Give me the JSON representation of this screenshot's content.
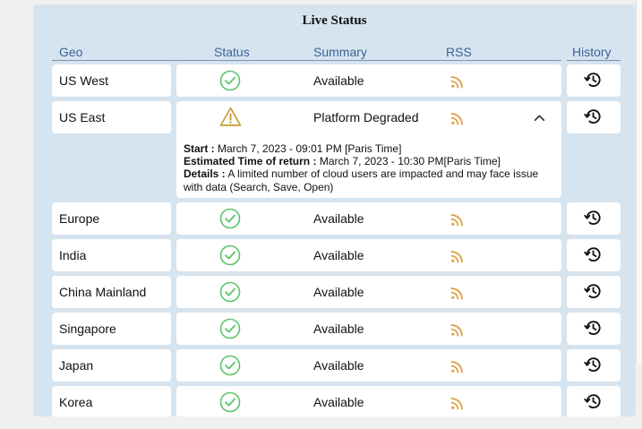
{
  "title": "Live Status",
  "headers": {
    "geo": "Geo",
    "status": "Status",
    "summary": "Summary",
    "rss": "RSS",
    "history": "History"
  },
  "rows": [
    {
      "geo": "US West",
      "status": "ok",
      "summary": "Available"
    },
    {
      "geo": "US East",
      "status": "warning",
      "summary": "Platform Degraded",
      "details": {
        "start_label": "Start :",
        "start_value": " March 7, 2023 - 09:01 PM [Paris Time]",
        "eta_label": "Estimated Time of return :",
        "eta_value": " March 7, 2023 - 10:30 PM[Paris Time]",
        "details_label": "Details :",
        "details_value": " A limited number of cloud users are impacted and may face issue with data (Search, Save, Open)"
      }
    },
    {
      "geo": "Europe",
      "status": "ok",
      "summary": "Available"
    },
    {
      "geo": "India",
      "status": "ok",
      "summary": "Available"
    },
    {
      "geo": "China Mainland",
      "status": "ok",
      "summary": "Available"
    },
    {
      "geo": "Singapore",
      "status": "ok",
      "summary": "Available"
    },
    {
      "geo": "Japan",
      "status": "ok",
      "summary": "Available"
    },
    {
      "geo": "Korea",
      "status": "ok",
      "summary": "Available"
    }
  ],
  "icons": {
    "ok": "check-circle-icon",
    "warning": "warning-triangle-icon",
    "rss": "rss-icon",
    "history": "history-icon",
    "collapse": "chevron-up-icon"
  },
  "colors": {
    "ok": "#5cc46a",
    "warning": "#c79a36",
    "rss": "#e0a040",
    "panel": "#d6e4ef"
  }
}
